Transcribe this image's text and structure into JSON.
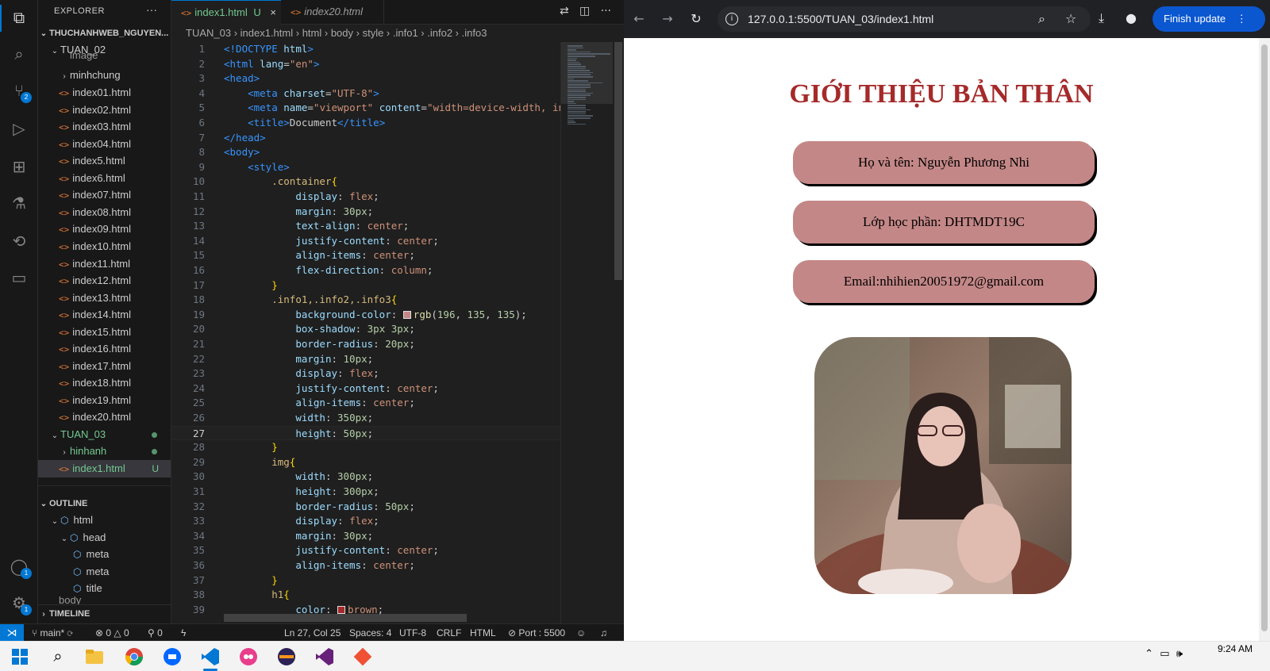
{
  "vscode": {
    "explorer_title": "EXPLORER",
    "more_label": "···",
    "workspace": "THUCHANHWEB_NGUYEN...",
    "folder_tuan02": "TUAN_02",
    "items_partial": "image",
    "folder_minhchung": "minhchung",
    "files_tuan02": [
      "index01.html",
      "index02.html",
      "index03.html",
      "index04.html",
      "index5.html",
      "index6.html",
      "index07.html",
      "index08.html",
      "index09.html",
      "index10.html",
      "index11.html",
      "index12.html",
      "index13.html",
      "index14.html",
      "index15.html",
      "index16.html",
      "index17.html",
      "index18.html",
      "index19.html",
      "index20.html"
    ],
    "folder_tuan03": "TUAN_03",
    "folder_hinhanh": "hinhanh",
    "file_active": "index1.html",
    "file_active_status": "U",
    "outline_title": "OUTLINE",
    "outline_items": [
      "html",
      "head",
      "meta",
      "meta",
      "title"
    ],
    "outline_partial": "body",
    "timeline_title": "TIMELINE",
    "badges": {
      "source_control": "2",
      "accounts": "1",
      "settings": "1"
    },
    "tabs": [
      {
        "label": "index1.html",
        "status": "U",
        "close": "×"
      },
      {
        "label": "index20.html"
      }
    ],
    "html_icon": "<>",
    "breadcrumb": [
      "TUAN_03",
      "index1.html",
      "html",
      "body",
      "style",
      ".info1",
      ".info2",
      ".info3"
    ],
    "code_lines": [
      {
        "n": "1",
        "html": "<span class='tg'>&lt;!DOCTYPE</span> <span class='at'>html</span><span class='tg'>&gt;</span>"
      },
      {
        "n": "2",
        "html": "<span class='tg'>&lt;html</span> <span class='at'>lang</span>=<span class='str'>\"en\"</span><span class='tg'>&gt;</span>"
      },
      {
        "n": "3",
        "html": "<span class='tg'>&lt;head&gt;</span>"
      },
      {
        "n": "4",
        "html": "    <span class='tg'>&lt;meta</span> <span class='at'>charset</span>=<span class='str'>\"UTF-8\"</span><span class='tg'>&gt;</span>"
      },
      {
        "n": "5",
        "html": "    <span class='tg'>&lt;meta</span> <span class='at'>name</span>=<span class='str'>\"viewport\"</span> <span class='at'>content</span>=<span class='str'>\"width=device-width, in</span>"
      },
      {
        "n": "6",
        "html": "    <span class='tg'>&lt;title&gt;</span>Document<span class='tg'>&lt;/title&gt;</span>"
      },
      {
        "n": "7",
        "html": "<span class='tg'>&lt;/head&gt;</span>"
      },
      {
        "n": "8",
        "html": "<span class='tg'>&lt;body&gt;</span>"
      },
      {
        "n": "9",
        "html": "    <span class='tg'>&lt;style&gt;</span>"
      },
      {
        "n": "10",
        "html": "        <span class='sel'>.container</span><span class='br'>{</span>"
      },
      {
        "n": "11",
        "html": "            <span class='prop'>display</span>: <span class='val'>flex</span>;"
      },
      {
        "n": "12",
        "html": "            <span class='prop'>margin</span>: <span class='num'>30px</span>;"
      },
      {
        "n": "13",
        "html": "            <span class='prop'>text-align</span>: <span class='val'>center</span>;"
      },
      {
        "n": "14",
        "html": "            <span class='prop'>justify-content</span>: <span class='val'>center</span>;"
      },
      {
        "n": "15",
        "html": "            <span class='prop'>align-items</span>: <span class='val'>center</span>;"
      },
      {
        "n": "16",
        "html": "            <span class='prop'>flex-direction</span>: <span class='val'>column</span>;"
      },
      {
        "n": "17",
        "html": "        <span class='br'>}</span>"
      },
      {
        "n": "18",
        "html": "        <span class='sel'>.info1,.info2,.info3</span><span class='br'>{</span>"
      },
      {
        "n": "19",
        "html": "            <span class='prop'>background-color</span>: <span class='swatch' style='background:#c48787'></span><span class='fn'>rgb</span>(<span class='num'>196</span>, <span class='num'>135</span>, <span class='num'>135</span>);"
      },
      {
        "n": "20",
        "html": "            <span class='prop'>box-shadow</span>: <span class='num'>3px</span> <span class='num'>3px</span>;"
      },
      {
        "n": "21",
        "html": "            <span class='prop'>border-radius</span>: <span class='num'>20px</span>;"
      },
      {
        "n": "22",
        "html": "            <span class='prop'>margin</span>: <span class='num'>10px</span>;"
      },
      {
        "n": "23",
        "html": "            <span class='prop'>display</span>: <span class='val'>flex</span>;"
      },
      {
        "n": "24",
        "html": "            <span class='prop'>justify-content</span>: <span class='val'>center</span>;"
      },
      {
        "n": "25",
        "html": "            <span class='prop'>align-items</span>: <span class='val'>center</span>;"
      },
      {
        "n": "26",
        "html": "            <span class='prop'>width</span>: <span class='num'>350px</span>;"
      },
      {
        "n": "27",
        "html": "            <span class='prop'>height</span>: <span class='num'>50px</span>;"
      },
      {
        "n": "28",
        "html": "        <span class='br'>}</span>"
      },
      {
        "n": "29",
        "html": "        <span class='sel'>img</span><span class='br'>{</span>"
      },
      {
        "n": "30",
        "html": "            <span class='prop'>width</span>: <span class='num'>300px</span>;"
      },
      {
        "n": "31",
        "html": "            <span class='prop'>height</span>: <span class='num'>300px</span>;"
      },
      {
        "n": "32",
        "html": "            <span class='prop'>border-radius</span>: <span class='num'>50px</span>;"
      },
      {
        "n": "33",
        "html": "            <span class='prop'>display</span>: <span class='val'>flex</span>;"
      },
      {
        "n": "34",
        "html": "            <span class='prop'>margin</span>: <span class='num'>30px</span>;"
      },
      {
        "n": "35",
        "html": "            <span class='prop'>justify-content</span>: <span class='val'>center</span>;"
      },
      {
        "n": "36",
        "html": "            <span class='prop'>align-items</span>: <span class='val'>center</span>;"
      },
      {
        "n": "37",
        "html": "        <span class='br'>}</span>"
      },
      {
        "n": "38",
        "html": "        <span class='sel'>h1</span><span class='br'>{</span>"
      },
      {
        "n": "39",
        "html": "            <span class='prop'>color</span>: <span class='swatch' style='background:#a52a2a'></span><span class='val'>brown</span>;"
      }
    ],
    "current_line": "27",
    "status": {
      "branch": "main*",
      "errors": "⊗ 0 △ 0",
      "ports": "⚲ 0",
      "position": "Ln 27, Col 25",
      "spaces": "Spaces: 4",
      "encoding": "UTF-8",
      "eol": "CRLF",
      "language": "HTML",
      "port": "⊘ Port : 5500"
    }
  },
  "browser": {
    "url": "127.0.0.1:5500/TUAN_03/index1.html",
    "finish_update": "Finish update",
    "page": {
      "title": "GIỚI THIỆU BẢN THÂN",
      "info1": "Họ và tên: Nguyễn Phương Nhi",
      "info2": "Lớp học phần: DHTMDT19C",
      "info3": "Email:nhihien20051972@gmail.com"
    }
  },
  "taskbar": {
    "time": "9:24 AM"
  },
  "colors": {
    "accent": "#0078d4",
    "info_bg": "#c48787",
    "h1_color": "#a52a2a"
  }
}
